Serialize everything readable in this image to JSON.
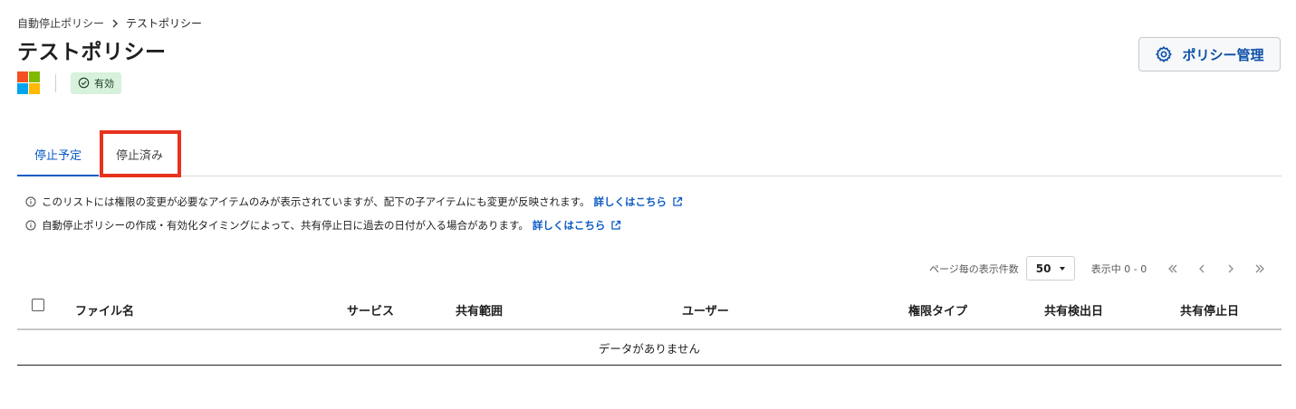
{
  "breadcrumb": {
    "parent": "自動停止ポリシー",
    "current": "テストポリシー"
  },
  "page": {
    "title": "テストポリシー"
  },
  "status": {
    "badge": "有効"
  },
  "actions": {
    "policy_manage": "ポリシー管理"
  },
  "tabs": [
    {
      "label": "停止予定",
      "active": true
    },
    {
      "label": "停止済み",
      "active": false
    }
  ],
  "notices": [
    {
      "text": "このリストには権限の変更が必要なアイテムのみが表示されていますが、配下の子アイテムにも変更が反映されます。",
      "link": "詳しくはこちら"
    },
    {
      "text": "自動停止ポリシーの作成・有効化タイミングによって、共有停止日に過去の日付が入る場合があります。",
      "link": "詳しくはこちら"
    }
  ],
  "pagination": {
    "per_page_label": "ページ毎の表示件数",
    "per_page_value": "50",
    "range": "表示中 0 - 0"
  },
  "table": {
    "columns": [
      "ファイル名",
      "サービス",
      "共有範囲",
      "ユーザー",
      "権限タイプ",
      "共有検出日",
      "共有停止日"
    ],
    "empty": "データがありません"
  },
  "colors": {
    "accent": "#0b5bc4",
    "highlight": "#e8321e",
    "badge_bg": "#d7f1dc"
  }
}
